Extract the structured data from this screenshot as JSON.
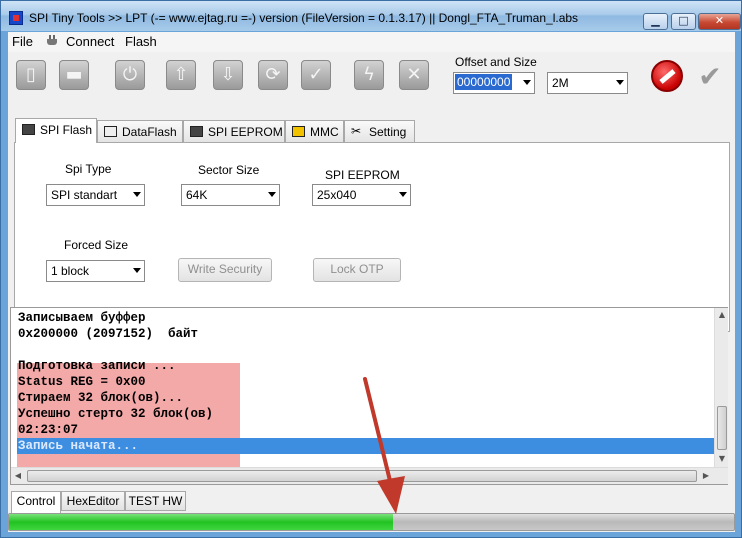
{
  "window": {
    "title": "SPI Tiny Tools >> LPT (-= www.ejtag.ru =-) version (FileVersion = 0.1.3.17) || Dongl_FTA_Truman_l.abs",
    "minimize_glyph": "▁",
    "maximize_glyph": "□",
    "close_glyph": "✕"
  },
  "menu": {
    "items": [
      {
        "label": "File"
      },
      {
        "label": "Connect"
      },
      {
        "label": "Flash"
      }
    ]
  },
  "toolbar": {
    "buttons": [
      {
        "icon": "open-file-icon",
        "glyph": "▯"
      },
      {
        "icon": "save-icon",
        "glyph": "▬"
      },
      {
        "icon": "connect-device-icon",
        "glyph": "⏻"
      },
      {
        "icon": "upload-icon",
        "glyph": "⇧"
      },
      {
        "icon": "download-icon",
        "glyph": "⇩"
      },
      {
        "icon": "refresh-icon",
        "glyph": "⟳"
      },
      {
        "icon": "verify-icon",
        "glyph": "✓"
      },
      {
        "icon": "flash-bolt-icon",
        "glyph": "ϟ"
      },
      {
        "icon": "erase-icon",
        "glyph": "✕"
      }
    ],
    "offset_label": "Offset and Size",
    "offset_value": "00000000",
    "size_value": "2M"
  },
  "tabs": [
    {
      "label": "SPI Flash",
      "active": true
    },
    {
      "label": "DataFlash",
      "active": false
    },
    {
      "label": "SPI EEPROM",
      "active": false
    },
    {
      "label": "MMC",
      "active": false
    },
    {
      "label": "Setting",
      "active": false
    }
  ],
  "spi_flash": {
    "spi_type_label": "Spi Type",
    "spi_type_value": "SPI standart",
    "sector_size_label": "Sector Size",
    "sector_size_value": "64K",
    "spi_eeprom_label": "SPI EEPROM",
    "spi_eeprom_value": "25x040",
    "forced_size_label": "Forced Size",
    "forced_size_value": "1 block",
    "write_security_label": "Write Security",
    "lock_otp_label": "Lock OTP"
  },
  "log": {
    "lines": [
      "Записываем буффер",
      "0x200000 (2097152)  байт",
      "",
      "Подготовка записи ...",
      "Status REG = 0x00",
      "Стираем 32 блок(ов)...",
      "Успешно стерто 32 блок(ов)",
      "02:23:07",
      "Запись начата..."
    ]
  },
  "bottom_tabs": [
    {
      "label": "Control",
      "active": true
    },
    {
      "label": "HexEditor",
      "active": false
    },
    {
      "label": "TEST HW",
      "active": false
    }
  ],
  "progress": {
    "fraction": 0.53
  },
  "colors": {
    "log_highlight": "#f4a9a9",
    "log_selection": "#3d8ee0",
    "progress_green": "#22c322",
    "annotation_arrow": "#c0392b"
  }
}
